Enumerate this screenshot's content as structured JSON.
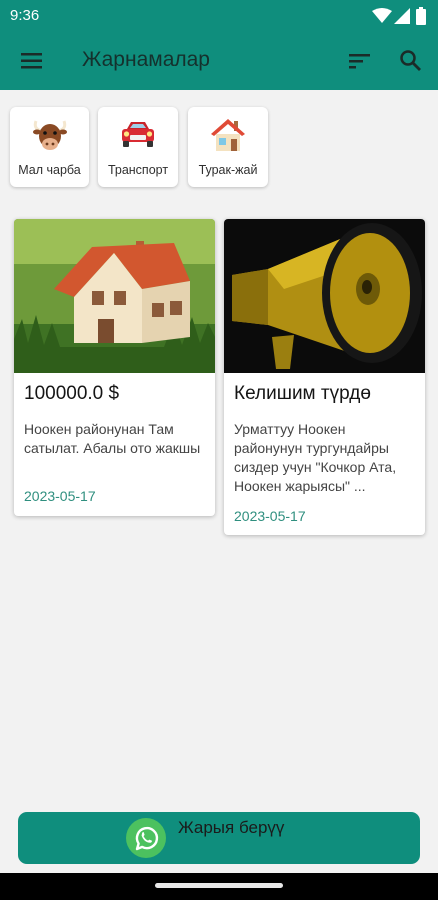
{
  "status_bar": {
    "time": "9:36"
  },
  "app_bar": {
    "title": "Жарнамалар",
    "menu_icon": "hamburger-icon",
    "sort_icon": "sort-icon",
    "search_icon": "search-icon"
  },
  "categories": [
    {
      "label": "Мал чарба",
      "icon": "bull-icon"
    },
    {
      "label": "Транспорт",
      "icon": "car-icon"
    },
    {
      "label": "Турак-жай",
      "icon": "house-icon"
    }
  ],
  "listings": [
    {
      "title": "100000.0 $",
      "description": "Ноокен районунан Там сатылат. Абалы ото жакшы",
      "date": "2023-05-17",
      "image": "house-photo"
    },
    {
      "title": "Келишим түрдө",
      "description": "Урматтуу Ноокен районунун тургундайры сиздер учун \"Кочкор Ата, Ноокен жарыясы\" ...",
      "date": "2023-05-17",
      "image": "megaphone-photo"
    }
  ],
  "post_ad_button": {
    "label": "Жарыя берүү",
    "icon": "whatsapp-icon"
  },
  "colors": {
    "primary": "#0f8e7d",
    "date_text": "#2f8f7f",
    "background": "#f2f2f2"
  }
}
